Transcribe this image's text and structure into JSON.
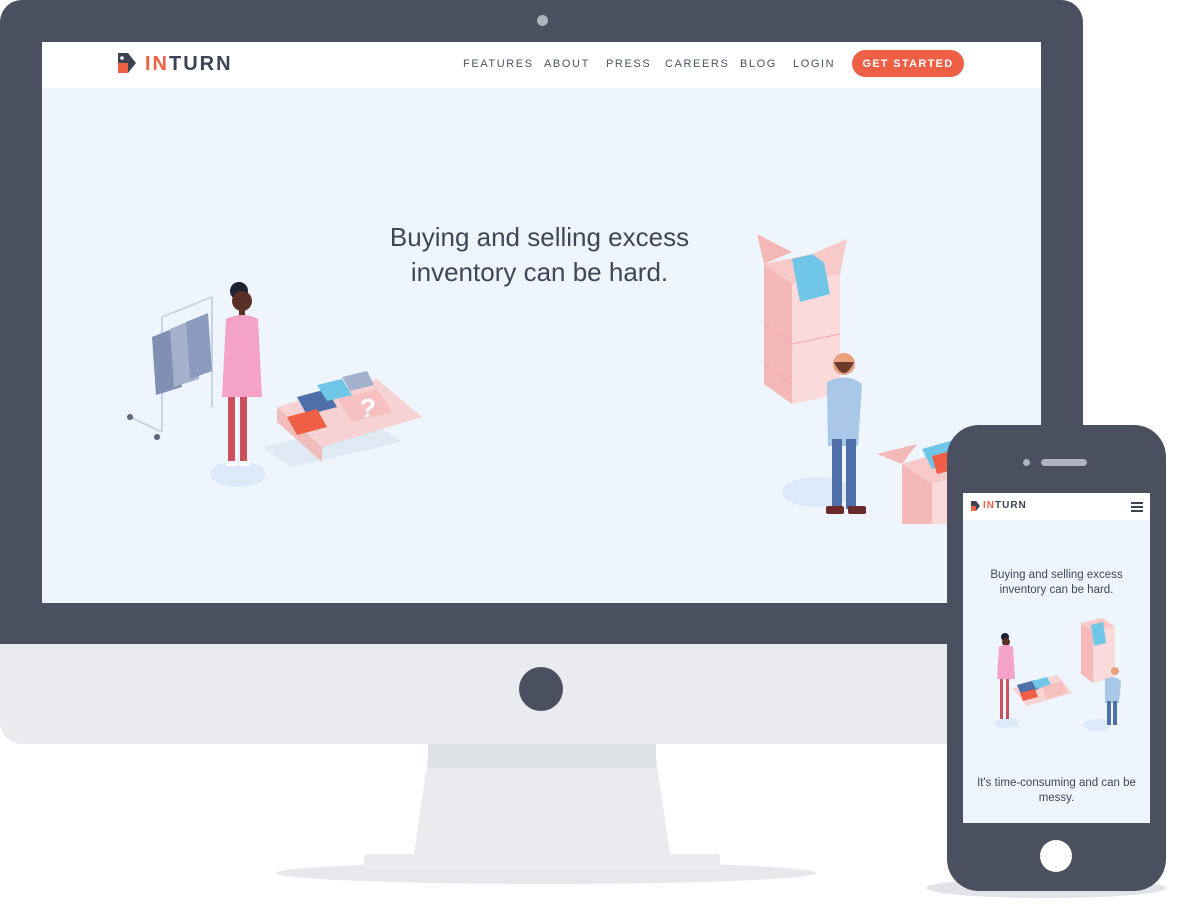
{
  "brand": {
    "logo_part1": "IN",
    "logo_part2": "TURN",
    "colors": {
      "accent": "#ee5f45",
      "navy": "#3c4353",
      "bezel": "#4a505f",
      "hero_bg": "#eef5fd"
    }
  },
  "desktop": {
    "nav": {
      "links": [
        "FEATURES",
        "ABOUT",
        "PRESS",
        "CAREERS",
        "BLOG",
        "LOGIN"
      ],
      "cta": "GET STARTED"
    },
    "hero": {
      "headline_line1": "Buying and selling excess",
      "headline_line2": "inventory can be hard."
    }
  },
  "mobile": {
    "menu_icon": "hamburger-icon",
    "hero": {
      "headline_line1": "Buying and selling excess",
      "headline_line2": "inventory can be hard."
    },
    "subtext_line1": "It's time-consuming and can be",
    "subtext_line2": "messy."
  }
}
